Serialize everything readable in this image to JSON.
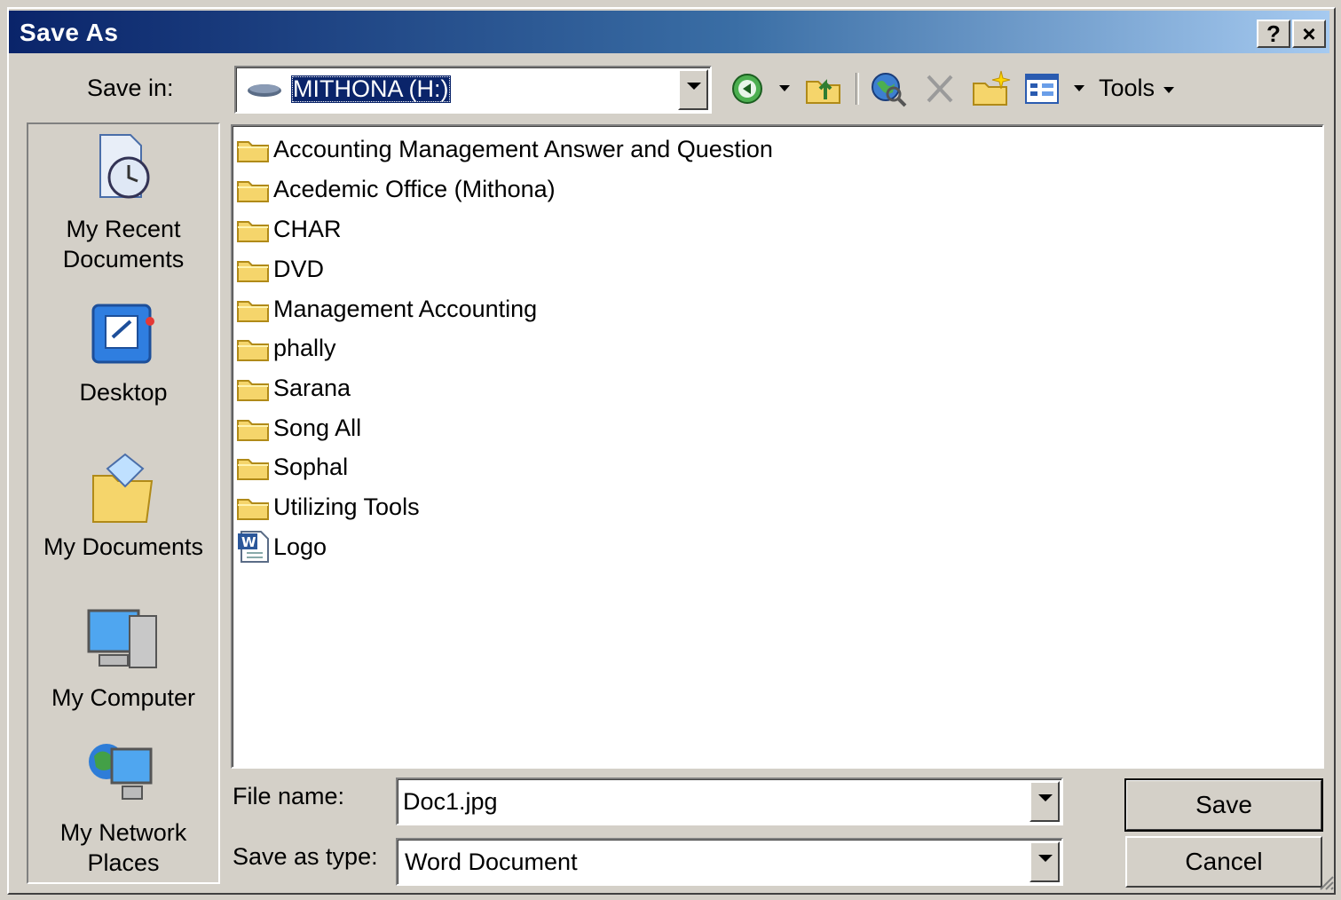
{
  "window": {
    "title": "Save As",
    "help_label": "?",
    "close_label": "×"
  },
  "save_in": {
    "label": "Save in:",
    "value": "MITHONA (H:)"
  },
  "toolbar": {
    "tools_label": "Tools",
    "icons": [
      "back-icon",
      "up-folder-icon",
      "search-web-icon",
      "delete-icon",
      "new-folder-icon",
      "views-icon"
    ]
  },
  "places": [
    {
      "label": "My Recent Documents",
      "icon": "recent-documents-icon"
    },
    {
      "label": "Desktop",
      "icon": "desktop-icon"
    },
    {
      "label": "My Documents",
      "icon": "my-documents-icon"
    },
    {
      "label": "My Computer",
      "icon": "my-computer-icon"
    },
    {
      "label": "My Network Places",
      "icon": "network-places-icon"
    }
  ],
  "files": [
    {
      "name": "Accounting Management Answer and Question",
      "type": "folder"
    },
    {
      "name": "Acedemic Office (Mithona)",
      "type": "folder"
    },
    {
      "name": "CHAR",
      "type": "folder"
    },
    {
      "name": "DVD",
      "type": "folder"
    },
    {
      "name": "Management Accounting",
      "type": "folder"
    },
    {
      "name": "phally",
      "type": "folder"
    },
    {
      "name": "Sarana",
      "type": "folder"
    },
    {
      "name": "Song All",
      "type": "folder"
    },
    {
      "name": "Sophal",
      "type": "folder"
    },
    {
      "name": "Utilizing Tools",
      "type": "folder"
    },
    {
      "name": "Logo",
      "type": "word-document"
    }
  ],
  "file_name": {
    "label": "File name:",
    "value": "Doc1.jpg"
  },
  "save_as_type": {
    "label": "Save as type:",
    "value": "Word Document"
  },
  "buttons": {
    "save": "Save",
    "cancel": "Cancel"
  },
  "colors": {
    "title_start": "#0a246a",
    "title_end": "#a6caf0",
    "face": "#d4d0c8",
    "folder": "#f5d56b"
  }
}
